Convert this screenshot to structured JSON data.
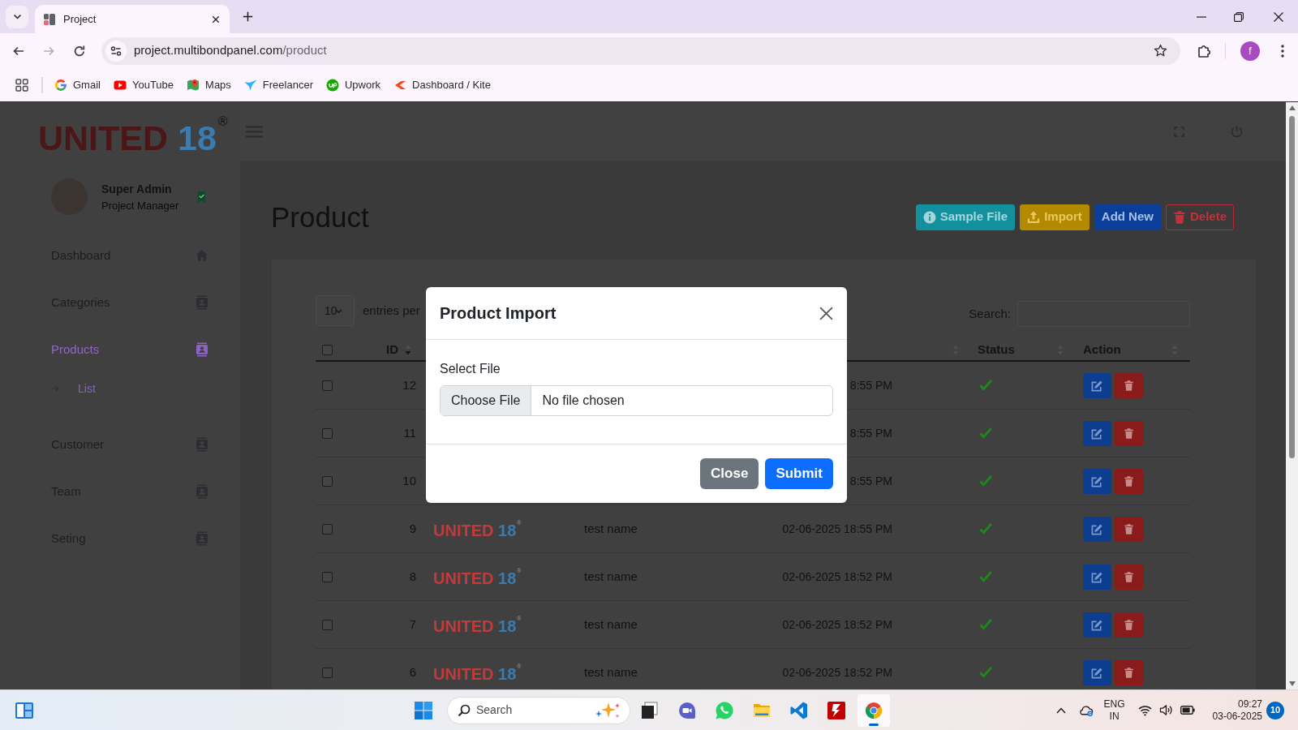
{
  "browser": {
    "tabs": [
      {
        "title": "Project",
        "selected": true
      }
    ],
    "nav": [
      {
        "kind": "back",
        "disabled": false
      },
      {
        "kind": "forward",
        "disabled": true
      },
      {
        "kind": "reload",
        "disabled": false
      }
    ],
    "address": {
      "host": "project.multibondpanel.com",
      "path": "/product"
    },
    "profile": "f",
    "bookmarks": [
      {
        "kind": "google",
        "label": "Gmail"
      },
      {
        "kind": "video",
        "label": "YouTube"
      },
      {
        "kind": "maps",
        "label": "Maps"
      },
      {
        "kind": "bird",
        "label": "Freelancer"
      },
      {
        "kind": "upwork",
        "label": "Upwork"
      },
      {
        "kind": "kite",
        "label": "Dashboard / Kite"
      }
    ]
  },
  "sidebar": {
    "logo": {
      "word": "UNITED",
      "number": "18",
      "mark": "®"
    },
    "user": {
      "name": "Super Admin",
      "role": "Project Manager"
    },
    "menu": [
      {
        "label": "Dashboard",
        "kind": "home",
        "selected": false
      },
      {
        "label": "Categories",
        "kind": "card",
        "selected": false
      },
      {
        "label": "Products",
        "kind": "card",
        "selected": true,
        "children": [
          {
            "label": "List",
            "selected": true
          }
        ]
      },
      {
        "label": "Customer",
        "kind": "card",
        "selected": false
      },
      {
        "label": "Team",
        "kind": "card",
        "selected": false
      },
      {
        "label": "Seting",
        "kind": "card",
        "selected": false
      }
    ]
  },
  "page": {
    "title": "Product",
    "actions": [
      {
        "kind": "info",
        "label": "Sample File"
      },
      {
        "kind": "import",
        "label": "Import"
      },
      {
        "kind": "add",
        "label": "Add New"
      },
      {
        "kind": "delete",
        "label": "Delete"
      }
    ]
  },
  "table": {
    "page_size": "10",
    "entries_label": "entries per",
    "search_label": "Search:",
    "columns": [
      {
        "kind": "checkbox",
        "checked": false
      },
      {
        "kind": "header",
        "label": "ID",
        "sorted": true
      },
      {
        "kind": "covered"
      },
      {
        "kind": "covered"
      },
      {
        "kind": "covered",
        "sorted": false
      },
      {
        "kind": "header",
        "label": "Status",
        "sorted": false
      },
      {
        "kind": "header",
        "label": "Action",
        "sorted": false
      }
    ],
    "rows": [
      {
        "id": "12",
        "checked": false,
        "date": "8:55 PM",
        "active": true
      },
      {
        "id": "11",
        "checked": false,
        "date": "8:55 PM",
        "active": true
      },
      {
        "id": "10",
        "checked": false,
        "date": "8:55 PM",
        "active": true
      },
      {
        "id": "9",
        "checked": false,
        "logo": {
          "word": "UNITED",
          "number": "18",
          "mark": "®"
        },
        "name": "test name",
        "date": "02-06-2025 18:55 PM",
        "active": true
      },
      {
        "id": "8",
        "checked": false,
        "logo": {
          "word": "UNITED",
          "number": "18",
          "mark": "®"
        },
        "name": "test name",
        "date": "02-06-2025 18:52 PM",
        "active": true
      },
      {
        "id": "7",
        "checked": false,
        "logo": {
          "word": "UNITED",
          "number": "18",
          "mark": "®"
        },
        "name": "test name",
        "date": "02-06-2025 18:52 PM",
        "active": true
      },
      {
        "id": "6",
        "checked": false,
        "logo": {
          "word": "UNITED",
          "number": "18",
          "mark": "®"
        },
        "name": "test name",
        "date": "02-06-2025 18:52 PM",
        "active": true
      }
    ]
  },
  "modal": {
    "title": "Product Import",
    "field_label": "Select File",
    "file_button": "Choose File",
    "file_status": "No file chosen",
    "buttons": [
      {
        "kind": "secondary",
        "label": "Close"
      },
      {
        "kind": "primary",
        "label": "Submit"
      }
    ]
  },
  "taskbar": {
    "search": {
      "placeholder": "Search"
    },
    "apps": [
      {
        "kind": "task_view",
        "active": false
      },
      {
        "kind": "video_chat",
        "active": false
      },
      {
        "kind": "chat",
        "active": false
      },
      {
        "kind": "folder",
        "active": false
      },
      {
        "kind": "code",
        "active": false
      },
      {
        "kind": "ftp",
        "active": false
      },
      {
        "kind": "browser",
        "active": true
      }
    ],
    "tray": {
      "language": "ENG",
      "region": "IN",
      "time": "09:27",
      "date": "03-06-2025",
      "notifications": "10"
    }
  }
}
